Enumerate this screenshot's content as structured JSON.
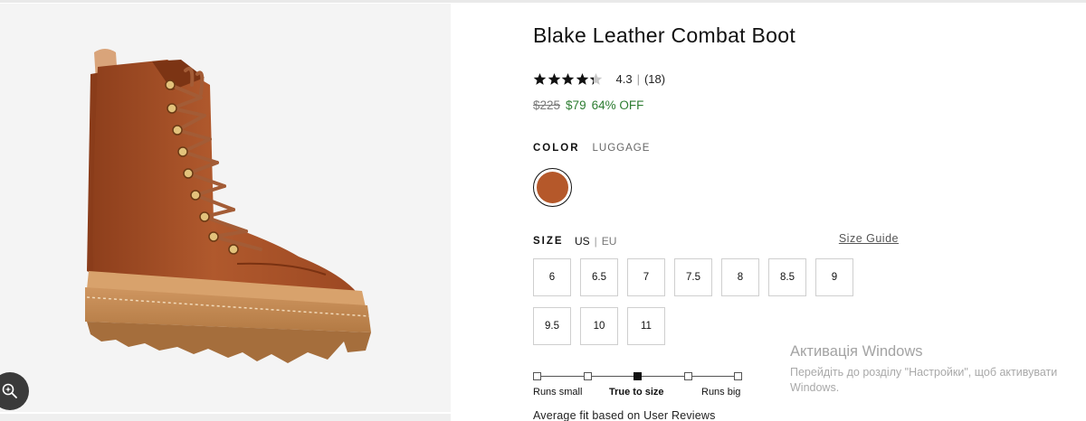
{
  "product": {
    "title": "Blake Leather Combat Boot",
    "rating": {
      "value": "4.3",
      "separator": "|",
      "count": "(18)",
      "stars_filled": 4.3,
      "stars_total": 5
    },
    "price": {
      "original": "$225",
      "sale": "$79",
      "discount": "64% OFF"
    },
    "color": {
      "label": "COLOR",
      "value": "LUGGAGE",
      "swatch_hex": "#b5582a"
    },
    "size": {
      "label": "SIZE",
      "unit_us": "US",
      "unit_separator": "|",
      "unit_eu": "EU",
      "guide_link": "Size Guide",
      "options": [
        "6",
        "6.5",
        "7",
        "7.5",
        "8",
        "8.5",
        "9",
        "9.5",
        "10",
        "11"
      ]
    },
    "fit": {
      "left_label": "Runs small",
      "middle_label": "True to size",
      "right_label": "Runs big",
      "selected_index": 2,
      "points": 5,
      "note": "Average fit based on User Reviews"
    }
  },
  "image": {
    "zoom_icon": "zoom-sparkle-icon"
  },
  "watermark": {
    "title": "Активація Windows",
    "body": "Перейдіть до розділу \"Настройки\", щоб активувати Windows."
  },
  "colors": {
    "sale_green": "#2e7d32",
    "boot_leather": "#a9532a",
    "boot_sole": "#c48a52"
  }
}
